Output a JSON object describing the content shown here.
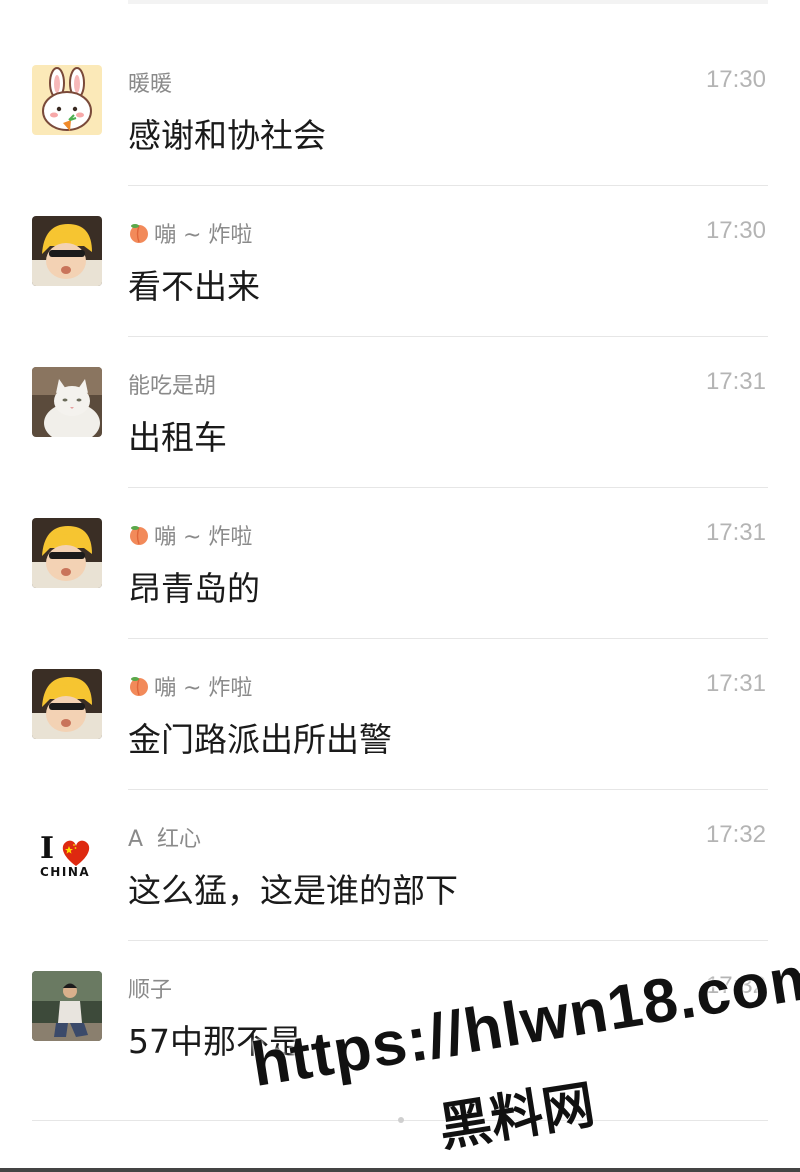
{
  "messages": [
    {
      "name": "暖暖",
      "time": "17:30",
      "text": "感谢和协社会",
      "avatar": "bunny-avatar",
      "peach": false
    },
    {
      "name": "嘣 ~ 炸啦",
      "time": "17:30",
      "text": "看不出来",
      "avatar": "yellow-hat-baby-avatar",
      "peach": true
    },
    {
      "name": "能吃是胡",
      "time": "17:31",
      "text": "出租车",
      "avatar": "white-cat-avatar",
      "peach": false
    },
    {
      "name": "嘣 ~ 炸啦",
      "time": "17:31",
      "text": "昂青岛的",
      "avatar": "yellow-hat-baby-avatar",
      "peach": true
    },
    {
      "name": "嘣 ~ 炸啦",
      "time": "17:31",
      "text": "金门路派出所出警",
      "avatar": "yellow-hat-baby-avatar",
      "peach": true
    },
    {
      "name": "A  红心",
      "time": "17:32",
      "text": "这么猛，这是谁的部下",
      "avatar": "i-love-china-avatar",
      "peach": false
    },
    {
      "name": "顺子",
      "time": "17:32",
      "text": "57中那不是",
      "avatar": "person-photo-avatar",
      "peach": false
    }
  ],
  "china_avatar": {
    "letter": "I",
    "word": "CHINA"
  },
  "watermark": {
    "url": "https://hlwn18.com",
    "cn": "黑料网"
  },
  "colors": {
    "name": "#8a8a8a",
    "time": "#b4b4b4",
    "text": "#1a1a1a",
    "divider": "#e6e6e6"
  }
}
